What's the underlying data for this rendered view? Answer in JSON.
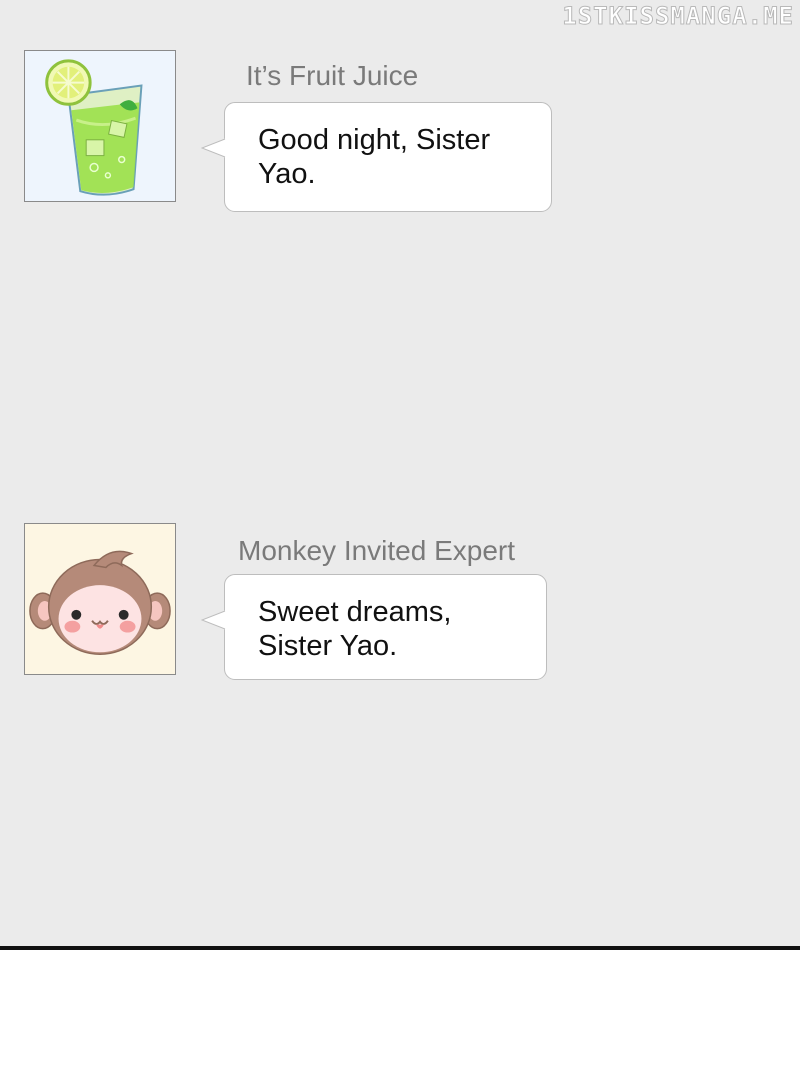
{
  "watermark": "1STKISSMANGA.ME",
  "messages": [
    {
      "sender": "It’s Fruit Juice",
      "avatar": "fruit-juice-glass-icon",
      "lines": [
        "Good night, Sister",
        "Yao."
      ]
    },
    {
      "sender": "Monkey Invited Expert",
      "avatar": "monkey-face-icon",
      "lines": [
        "Sweet dreams,",
        "Sister Yao."
      ]
    }
  ],
  "colors": {
    "chat_background": "#ebebeb",
    "bubble": "#ffffff",
    "bubble_border": "#bdbdbd",
    "sender_text": "#7a7a7a",
    "message_text": "#111111",
    "divider": "#111111"
  }
}
